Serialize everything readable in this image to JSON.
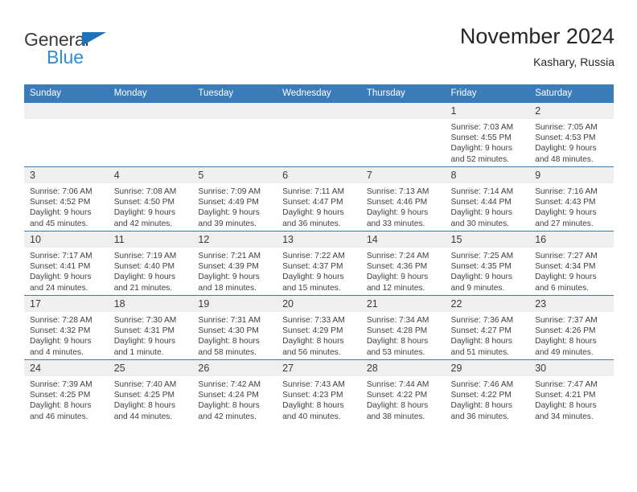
{
  "brand": {
    "word1": "General",
    "word2": "Blue",
    "triangle_color": "#1b72b8",
    "word2_color": "#2a8fd8"
  },
  "header": {
    "title": "November 2024",
    "location": "Kashary, Russia",
    "accent_color": "#3a7cb9",
    "daynum_band_color": "#efefef"
  },
  "weekday_headers": [
    "Sunday",
    "Monday",
    "Tuesday",
    "Wednesday",
    "Thursday",
    "Friday",
    "Saturday"
  ],
  "labels": {
    "sunrise_prefix": "Sunrise:",
    "sunset_prefix": "Sunset:",
    "daylight_prefix": "Daylight:"
  },
  "weeks": [
    [
      {
        "day": "",
        "empty": true
      },
      {
        "day": "",
        "empty": true
      },
      {
        "day": "",
        "empty": true
      },
      {
        "day": "",
        "empty": true
      },
      {
        "day": "",
        "empty": true
      },
      {
        "day": "1",
        "sunrise": "Sunrise: 7:03 AM",
        "sunset": "Sunset: 4:55 PM",
        "daylight_line1": "Daylight: 9 hours",
        "daylight_line2": "and 52 minutes."
      },
      {
        "day": "2",
        "sunrise": "Sunrise: 7:05 AM",
        "sunset": "Sunset: 4:53 PM",
        "daylight_line1": "Daylight: 9 hours",
        "daylight_line2": "and 48 minutes."
      }
    ],
    [
      {
        "day": "3",
        "sunrise": "Sunrise: 7:06 AM",
        "sunset": "Sunset: 4:52 PM",
        "daylight_line1": "Daylight: 9 hours",
        "daylight_line2": "and 45 minutes."
      },
      {
        "day": "4",
        "sunrise": "Sunrise: 7:08 AM",
        "sunset": "Sunset: 4:50 PM",
        "daylight_line1": "Daylight: 9 hours",
        "daylight_line2": "and 42 minutes."
      },
      {
        "day": "5",
        "sunrise": "Sunrise: 7:09 AM",
        "sunset": "Sunset: 4:49 PM",
        "daylight_line1": "Daylight: 9 hours",
        "daylight_line2": "and 39 minutes."
      },
      {
        "day": "6",
        "sunrise": "Sunrise: 7:11 AM",
        "sunset": "Sunset: 4:47 PM",
        "daylight_line1": "Daylight: 9 hours",
        "daylight_line2": "and 36 minutes."
      },
      {
        "day": "7",
        "sunrise": "Sunrise: 7:13 AM",
        "sunset": "Sunset: 4:46 PM",
        "daylight_line1": "Daylight: 9 hours",
        "daylight_line2": "and 33 minutes."
      },
      {
        "day": "8",
        "sunrise": "Sunrise: 7:14 AM",
        "sunset": "Sunset: 4:44 PM",
        "daylight_line1": "Daylight: 9 hours",
        "daylight_line2": "and 30 minutes."
      },
      {
        "day": "9",
        "sunrise": "Sunrise: 7:16 AM",
        "sunset": "Sunset: 4:43 PM",
        "daylight_line1": "Daylight: 9 hours",
        "daylight_line2": "and 27 minutes."
      }
    ],
    [
      {
        "day": "10",
        "sunrise": "Sunrise: 7:17 AM",
        "sunset": "Sunset: 4:41 PM",
        "daylight_line1": "Daylight: 9 hours",
        "daylight_line2": "and 24 minutes."
      },
      {
        "day": "11",
        "sunrise": "Sunrise: 7:19 AM",
        "sunset": "Sunset: 4:40 PM",
        "daylight_line1": "Daylight: 9 hours",
        "daylight_line2": "and 21 minutes."
      },
      {
        "day": "12",
        "sunrise": "Sunrise: 7:21 AM",
        "sunset": "Sunset: 4:39 PM",
        "daylight_line1": "Daylight: 9 hours",
        "daylight_line2": "and 18 minutes."
      },
      {
        "day": "13",
        "sunrise": "Sunrise: 7:22 AM",
        "sunset": "Sunset: 4:37 PM",
        "daylight_line1": "Daylight: 9 hours",
        "daylight_line2": "and 15 minutes."
      },
      {
        "day": "14",
        "sunrise": "Sunrise: 7:24 AM",
        "sunset": "Sunset: 4:36 PM",
        "daylight_line1": "Daylight: 9 hours",
        "daylight_line2": "and 12 minutes."
      },
      {
        "day": "15",
        "sunrise": "Sunrise: 7:25 AM",
        "sunset": "Sunset: 4:35 PM",
        "daylight_line1": "Daylight: 9 hours",
        "daylight_line2": "and 9 minutes."
      },
      {
        "day": "16",
        "sunrise": "Sunrise: 7:27 AM",
        "sunset": "Sunset: 4:34 PM",
        "daylight_line1": "Daylight: 9 hours",
        "daylight_line2": "and 6 minutes."
      }
    ],
    [
      {
        "day": "17",
        "sunrise": "Sunrise: 7:28 AM",
        "sunset": "Sunset: 4:32 PM",
        "daylight_line1": "Daylight: 9 hours",
        "daylight_line2": "and 4 minutes."
      },
      {
        "day": "18",
        "sunrise": "Sunrise: 7:30 AM",
        "sunset": "Sunset: 4:31 PM",
        "daylight_line1": "Daylight: 9 hours",
        "daylight_line2": "and 1 minute."
      },
      {
        "day": "19",
        "sunrise": "Sunrise: 7:31 AM",
        "sunset": "Sunset: 4:30 PM",
        "daylight_line1": "Daylight: 8 hours",
        "daylight_line2": "and 58 minutes."
      },
      {
        "day": "20",
        "sunrise": "Sunrise: 7:33 AM",
        "sunset": "Sunset: 4:29 PM",
        "daylight_line1": "Daylight: 8 hours",
        "daylight_line2": "and 56 minutes."
      },
      {
        "day": "21",
        "sunrise": "Sunrise: 7:34 AM",
        "sunset": "Sunset: 4:28 PM",
        "daylight_line1": "Daylight: 8 hours",
        "daylight_line2": "and 53 minutes."
      },
      {
        "day": "22",
        "sunrise": "Sunrise: 7:36 AM",
        "sunset": "Sunset: 4:27 PM",
        "daylight_line1": "Daylight: 8 hours",
        "daylight_line2": "and 51 minutes."
      },
      {
        "day": "23",
        "sunrise": "Sunrise: 7:37 AM",
        "sunset": "Sunset: 4:26 PM",
        "daylight_line1": "Daylight: 8 hours",
        "daylight_line2": "and 49 minutes."
      }
    ],
    [
      {
        "day": "24",
        "sunrise": "Sunrise: 7:39 AM",
        "sunset": "Sunset: 4:25 PM",
        "daylight_line1": "Daylight: 8 hours",
        "daylight_line2": "and 46 minutes."
      },
      {
        "day": "25",
        "sunrise": "Sunrise: 7:40 AM",
        "sunset": "Sunset: 4:25 PM",
        "daylight_line1": "Daylight: 8 hours",
        "daylight_line2": "and 44 minutes."
      },
      {
        "day": "26",
        "sunrise": "Sunrise: 7:42 AM",
        "sunset": "Sunset: 4:24 PM",
        "daylight_line1": "Daylight: 8 hours",
        "daylight_line2": "and 42 minutes."
      },
      {
        "day": "27",
        "sunrise": "Sunrise: 7:43 AM",
        "sunset": "Sunset: 4:23 PM",
        "daylight_line1": "Daylight: 8 hours",
        "daylight_line2": "and 40 minutes."
      },
      {
        "day": "28",
        "sunrise": "Sunrise: 7:44 AM",
        "sunset": "Sunset: 4:22 PM",
        "daylight_line1": "Daylight: 8 hours",
        "daylight_line2": "and 38 minutes."
      },
      {
        "day": "29",
        "sunrise": "Sunrise: 7:46 AM",
        "sunset": "Sunset: 4:22 PM",
        "daylight_line1": "Daylight: 8 hours",
        "daylight_line2": "and 36 minutes."
      },
      {
        "day": "30",
        "sunrise": "Sunrise: 7:47 AM",
        "sunset": "Sunset: 4:21 PM",
        "daylight_line1": "Daylight: 8 hours",
        "daylight_line2": "and 34 minutes."
      }
    ]
  ]
}
